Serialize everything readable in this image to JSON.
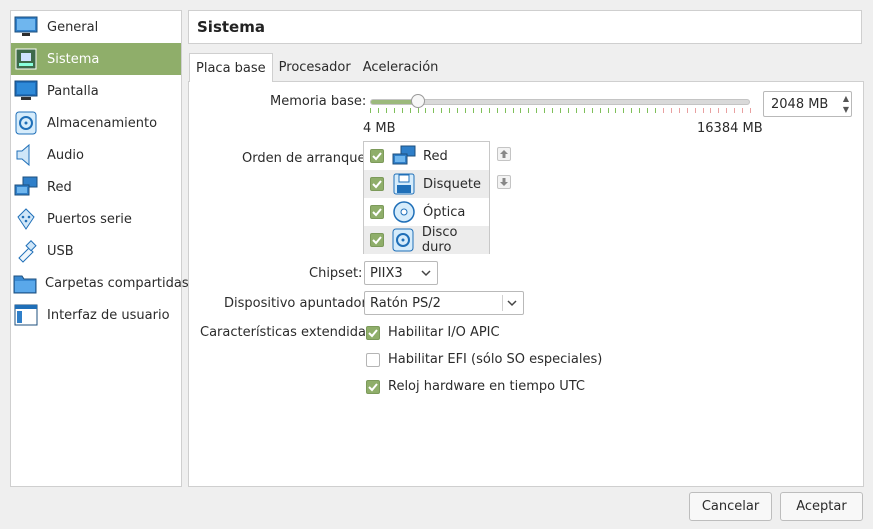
{
  "sidebar": {
    "items": [
      {
        "label": "General",
        "icon": "monitor-general-icon"
      },
      {
        "label": "Sistema",
        "icon": "motherboard-icon",
        "active": true
      },
      {
        "label": "Pantalla",
        "icon": "display-icon"
      },
      {
        "label": "Almacenamiento",
        "icon": "storage-disk-icon"
      },
      {
        "label": "Audio",
        "icon": "speaker-icon"
      },
      {
        "label": "Red",
        "icon": "network-icon"
      },
      {
        "label": "Puertos serie",
        "icon": "serial-port-icon"
      },
      {
        "label": "USB",
        "icon": "usb-icon"
      },
      {
        "label": "Carpetas compartidas",
        "icon": "shared-folder-icon"
      },
      {
        "label": "Interfaz de usuario",
        "icon": "user-interface-icon"
      }
    ]
  },
  "header": {
    "title": "Sistema"
  },
  "tabs": [
    {
      "label": "Placa base",
      "active": true
    },
    {
      "label": "Procesador",
      "active": false
    },
    {
      "label": "Aceleración",
      "active": false
    }
  ],
  "memory": {
    "label": "Memoria base:",
    "value": "2048 MB",
    "min_label": "4 MB",
    "max_label": "16384 MB",
    "min": 4,
    "max": 16384,
    "current": 2048
  },
  "boot_order": {
    "label": "Orden de arranque:",
    "items": [
      {
        "label": "Red",
        "checked": true,
        "icon": "network-icon"
      },
      {
        "label": "Disquete",
        "checked": true,
        "icon": "floppy-icon"
      },
      {
        "label": "Óptica",
        "checked": true,
        "icon": "optical-disc-icon"
      },
      {
        "label": "Disco duro",
        "checked": true,
        "icon": "hard-disk-icon"
      }
    ]
  },
  "chipset": {
    "label": "Chipset:",
    "value": "PIIX3"
  },
  "pointing_device": {
    "label": "Dispositivo apuntador:",
    "value": "Ratón PS/2"
  },
  "extended": {
    "label": "Características extendidas:",
    "options": [
      {
        "label": "Habilitar I/O APIC",
        "checked": true
      },
      {
        "label": "Habilitar EFI (sólo SO especiales)",
        "checked": false
      },
      {
        "label": "Reloj hardware en tiempo UTC",
        "checked": true
      }
    ]
  },
  "buttons": {
    "cancel": "Cancelar",
    "accept": "Aceptar"
  },
  "colors": {
    "accent": "#8fae6a",
    "slider_ok": "#7fbf5a",
    "slider_bad": "#e8a0a0"
  }
}
